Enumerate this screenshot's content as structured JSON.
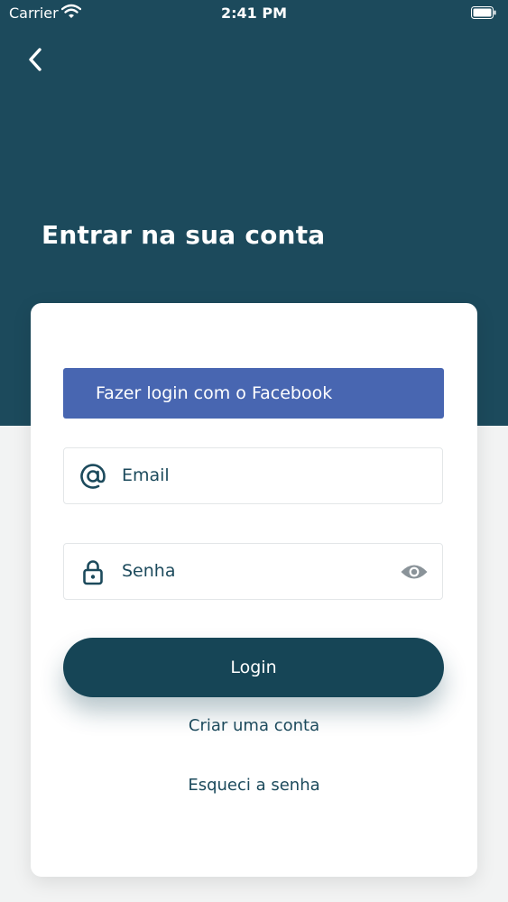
{
  "status_bar": {
    "carrier": "Carrier",
    "time": "2:41 PM"
  },
  "header": {
    "title": "Entrar na sua conta",
    "back_icon": "chevron-left-icon"
  },
  "form": {
    "facebook_button": "Fazer login com o Facebook",
    "email_field": {
      "value": "Email",
      "icon": "at-sign-icon"
    },
    "password_field": {
      "value": "Senha",
      "icon": "lock-icon",
      "toggle_icon": "eye-icon"
    },
    "login_button": "Login",
    "create_account_link": "Criar uma conta",
    "forgot_password_link": "Esqueci a senha"
  },
  "colors": {
    "header_bg": "#1c4a5c",
    "facebook": "#4866b1",
    "primary": "#164556",
    "page_bg": "#f2f3f3"
  }
}
